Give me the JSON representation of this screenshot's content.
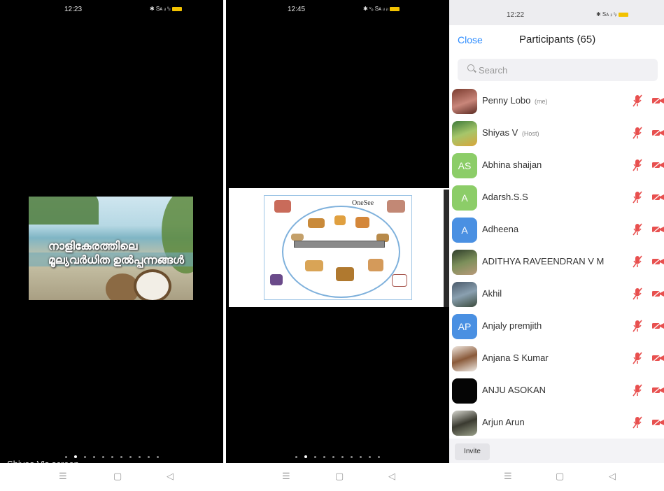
{
  "phone1": {
    "time": "12:23",
    "status_icons": "✱ Sᴀ ᵢₗ ᵗᵢₗ",
    "share_caption_line1": "നാളികേരത്തിലെ",
    "share_caption_line2": "മൂല്യവർധിത ഉൽപ്പന്നങ്ങൾ",
    "screen_label": "Shiyas V's screen"
  },
  "phone2": {
    "time": "12:45",
    "status_icons": "✱ ᵛₒ Sᴀ ᵢₗ ᵢₗ",
    "slide_title": "OneSee"
  },
  "phone3": {
    "time": "12:22",
    "status_icons": "✱ Sᴀ ᵢₗ ᵗᵢₗ",
    "close_label": "Close",
    "title": "Participants (65)",
    "search_placeholder": "Search",
    "invite_label": "Invite",
    "participants": [
      {
        "name": "Penny Lobo",
        "tag": "(me)",
        "avatar": "photo",
        "initials": ""
      },
      {
        "name": "Shiyas V",
        "tag": "(Host)",
        "avatar": "photo",
        "initials": ""
      },
      {
        "name": "Abhina shaijan",
        "tag": "",
        "avatar": "initials",
        "initials": "AS"
      },
      {
        "name": "Adarsh.S.S",
        "tag": "",
        "avatar": "initials",
        "initials": "A"
      },
      {
        "name": "Adheena",
        "tag": "",
        "avatar": "initials",
        "initials": "A"
      },
      {
        "name": "ADITHYA RAVEENDRAN V M",
        "tag": "",
        "avatar": "photo",
        "initials": ""
      },
      {
        "name": "Akhil",
        "tag": "",
        "avatar": "photo",
        "initials": ""
      },
      {
        "name": "Anjaly premjith",
        "tag": "",
        "avatar": "initials",
        "initials": "AP"
      },
      {
        "name": "Anjana S Kumar",
        "tag": "",
        "avatar": "photo",
        "initials": ""
      },
      {
        "name": "ANJU ASOKAN",
        "tag": "",
        "avatar": "photo",
        "initials": ""
      },
      {
        "name": "Arjun Arun",
        "tag": "",
        "avatar": "photo",
        "initials": ""
      }
    ]
  },
  "colors": {
    "accent": "#2d8cff",
    "muted_red": "#e8504f",
    "avatar_green": "#8ccd68",
    "avatar_blue": "#4a90e2"
  }
}
